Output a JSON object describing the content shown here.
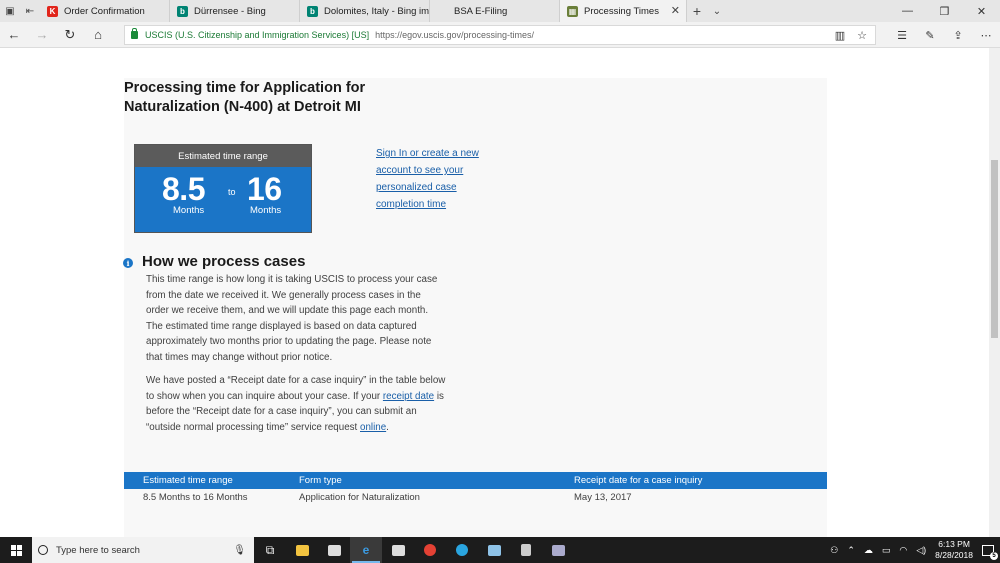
{
  "browser": {
    "tabs": [
      {
        "title": "Order Confirmation",
        "fav_color": "#e1251b",
        "fav_glyph": "K"
      },
      {
        "title": "Dürrensee - Bing",
        "fav_color": "#008373",
        "fav_glyph": "b"
      },
      {
        "title": "Dolomites, Italy - Bing imag",
        "fav_color": "#008373",
        "fav_glyph": "b"
      },
      {
        "title": "BSA E-Filing",
        "fav_color": "",
        "fav_glyph": ""
      },
      {
        "title": "Processing Times",
        "fav_color": "#6b7f3a",
        "fav_glyph": "▦",
        "active": true
      }
    ],
    "cert_label": "USCIS (U.S. Citizenship and Immigration Services) [US]",
    "url": "https://egov.uscis.gov/processing-times/"
  },
  "page": {
    "title": "Processing time for Application for Naturalization (N-400) at Detroit MI",
    "estimate": {
      "header": "Estimated time range",
      "low": "8.5",
      "high": "16",
      "to": "to",
      "unit": "Months"
    },
    "signin_link": "Sign In or create a new account to see your personalized case completion time",
    "how": {
      "title": "How we process cases",
      "para1": "This time range is how long it is taking USCIS to process your case from the date we received it. We generally process cases in the order we receive them, and we will update this page each month. The estimated time range displayed is based on data captured approximately two months prior to updating the page. Please note that times may change without prior notice.",
      "para2_a": "We have posted a “Receipt date for a case inquiry” in the table below to show when you can inquire about your case. If your ",
      "para2_link1": "receipt date",
      "para2_b": " is before the “Receipt date for a case inquiry”, you can submit an “outside normal processing time” service request ",
      "para2_link2": "online",
      "para2_c": "."
    },
    "table": {
      "headers": [
        "Estimated time range",
        "Form type",
        "Receipt date for a case inquiry"
      ],
      "rows": [
        [
          "8.5 Months to 16 Months",
          "Application for Naturalization",
          "May 13, 2017"
        ]
      ]
    }
  },
  "taskbar": {
    "search_placeholder": "Type here to search",
    "time": "6:13 PM",
    "date": "8/28/2018",
    "notifications": "5"
  }
}
